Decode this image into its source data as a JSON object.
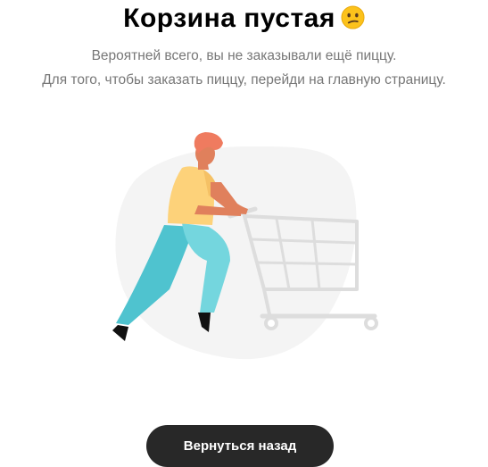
{
  "cart": {
    "title": "Корзина пустая",
    "emoji_icon": "confused-face-emoji",
    "subtitle_line1": "Вероятней всего, вы не заказывали ещё пиццу.",
    "subtitle_line2": "Для того, чтобы заказать пиццу, перейди на главную страницу.",
    "illustration_icon": "person-pushing-empty-cart-illustration",
    "back_button_label": "Вернуться назад"
  },
  "colors": {
    "button_bg": "#282828",
    "button_text": "#ffffff",
    "subtitle_text": "#777777",
    "title_text": "#000000",
    "blob": "#f4f4f4",
    "cart": "#dddddd",
    "shirt": "#fdd27a",
    "pants": "#5ccad6",
    "hair": "#ef7b5f",
    "skin": "#e0805c"
  }
}
